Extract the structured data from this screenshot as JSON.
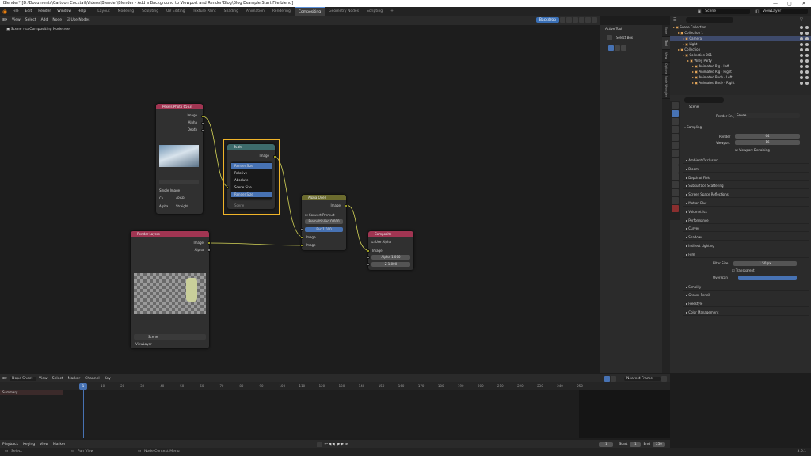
{
  "window": {
    "title": "Blender* [D:\\Documents\\Cartoon Cocktail\\Videos\\Blender\\Blender - Add a Background to Viewport and Render\\Blog\\Blog Example Start File.blend]",
    "controls": [
      "—",
      "▢",
      "✕"
    ]
  },
  "topbar": {
    "menus": [
      "File",
      "Edit",
      "Render",
      "Window",
      "Help"
    ],
    "workspaces": [
      "Layout",
      "Modeling",
      "Sculpting",
      "UV Editing",
      "Texture Paint",
      "Shading",
      "Animation",
      "Rendering",
      "Compositing",
      "Geometry Nodes",
      "Scripting",
      "+"
    ],
    "active_workspace": "Compositing",
    "scene": "Scene",
    "view_layer": "ViewLayer"
  },
  "editor_header": {
    "menus": [
      "View",
      "Select",
      "Add",
      "Node"
    ],
    "use_nodes": "Use Nodes",
    "backdrop": "Backdrop"
  },
  "breadcrumb": {
    "scene": "Scene",
    "tree": "Compositing Nodetree"
  },
  "n_panel": {
    "section": "Active Tool",
    "tool": "Select Box"
  },
  "side_tabs": [
    "Node",
    "Tool",
    "View",
    "Options",
    "Node Wrangler"
  ],
  "nodes": {
    "image": {
      "title": "Pexels Photo 6563",
      "outputs": [
        "Image",
        "Alpha",
        "Depth"
      ],
      "mode": "Single Image",
      "cs_label": "Co",
      "cs": "sRGB",
      "alpha_label": "Alpha",
      "alpha": "Straight"
    },
    "scale": {
      "title": "Scale",
      "output": "Image",
      "options": [
        "Render Size",
        "Relative",
        "Absolute",
        "Scene Size",
        "Render Size"
      ],
      "hint": "Stretch",
      "fade": "Scene"
    },
    "alpha_over": {
      "title": "Alpha Over",
      "convert": "Convert Premult",
      "premult_label": "Premultiplied",
      "premult": "0.000",
      "fac_label": "Fac",
      "fac": "1.000",
      "inputs": [
        "Image",
        "Image"
      ],
      "output": "Image"
    },
    "render": {
      "title": "Render Layers",
      "outputs": [
        "Image",
        "Alpha"
      ],
      "scene": "Scene",
      "layer": "ViewLayer"
    },
    "composite": {
      "title": "Composite",
      "use_alpha": "Use Alpha",
      "input": "Image",
      "alpha_label": "Alpha",
      "alpha": "1.000",
      "z_label": "Z",
      "z": "1.000"
    }
  },
  "outliner": {
    "rows": [
      {
        "label": "Scene Collection",
        "indent": 0
      },
      {
        "label": "Collection 1",
        "indent": 1
      },
      {
        "label": "Camera",
        "indent": 2,
        "sel": true
      },
      {
        "label": "Light",
        "indent": 2
      },
      {
        "label": "Collection",
        "indent": 1
      },
      {
        "label": "Collection 001",
        "indent": 2
      },
      {
        "label": "Wiley Party",
        "indent": 3
      },
      {
        "label": "Animated Rig - Left",
        "indent": 4
      },
      {
        "label": "Animated Rig - Right",
        "indent": 4
      },
      {
        "label": "Animated Body - Left",
        "indent": 4
      },
      {
        "label": "Animated Body - Right",
        "indent": 4
      }
    ]
  },
  "properties": {
    "scene": "Scene",
    "engine_label": "Render Engine",
    "engine": "Eevee",
    "sampling": "Sampling",
    "render_label": "Render",
    "render": "64",
    "viewport_label": "Viewport",
    "viewport": "16",
    "viewport_denoise": "Viewport Denoising",
    "panels": [
      "Ambient Occlusion",
      "Bloom",
      "Depth of Field",
      "Subsurface Scattering",
      "Screen Space Reflections",
      "Motion Blur",
      "Volumetrics",
      "Performance",
      "Curves",
      "Shadows",
      "Indirect Lighting",
      "Film"
    ],
    "film": {
      "filter_label": "Filter Size",
      "filter": "1.50 px",
      "transparent": "Transparent",
      "overscan": "Overscan"
    },
    "after": [
      "Simplify",
      "Grease Pencil",
      "Freestyle",
      "Color Management"
    ]
  },
  "timeline": {
    "editor": "Dope Sheet",
    "menus": [
      "View",
      "Select",
      "Marker",
      "Channel",
      "Key"
    ],
    "mode": "Nearest Frame",
    "summary": "Summary",
    "ticks": [
      "0",
      "10",
      "20",
      "30",
      "40",
      "50",
      "60",
      "70",
      "80",
      "90",
      "100",
      "110",
      "120",
      "130",
      "140",
      "150",
      "160",
      "170",
      "180",
      "190",
      "200",
      "210",
      "220",
      "230",
      "240",
      "250"
    ],
    "current": "1"
  },
  "playbar": {
    "menus": [
      "Playback",
      "Keying",
      "View",
      "Marker"
    ],
    "start_label": "Start",
    "start": "1",
    "end_label": "End",
    "end": "250",
    "frame": "1"
  },
  "status": {
    "left": "Select",
    "mid": "Pan View",
    "right": "Node Context Menu",
    "version": "3.6.1"
  },
  "colors": {
    "accent": "#5a8fd8",
    "highlight": "#f0b429",
    "image_header": "#a13552",
    "scale_header": "#3d6b6b",
    "mix_header": "#6b6b2e",
    "render_header": "#a13552",
    "comp_header": "#a13552"
  }
}
